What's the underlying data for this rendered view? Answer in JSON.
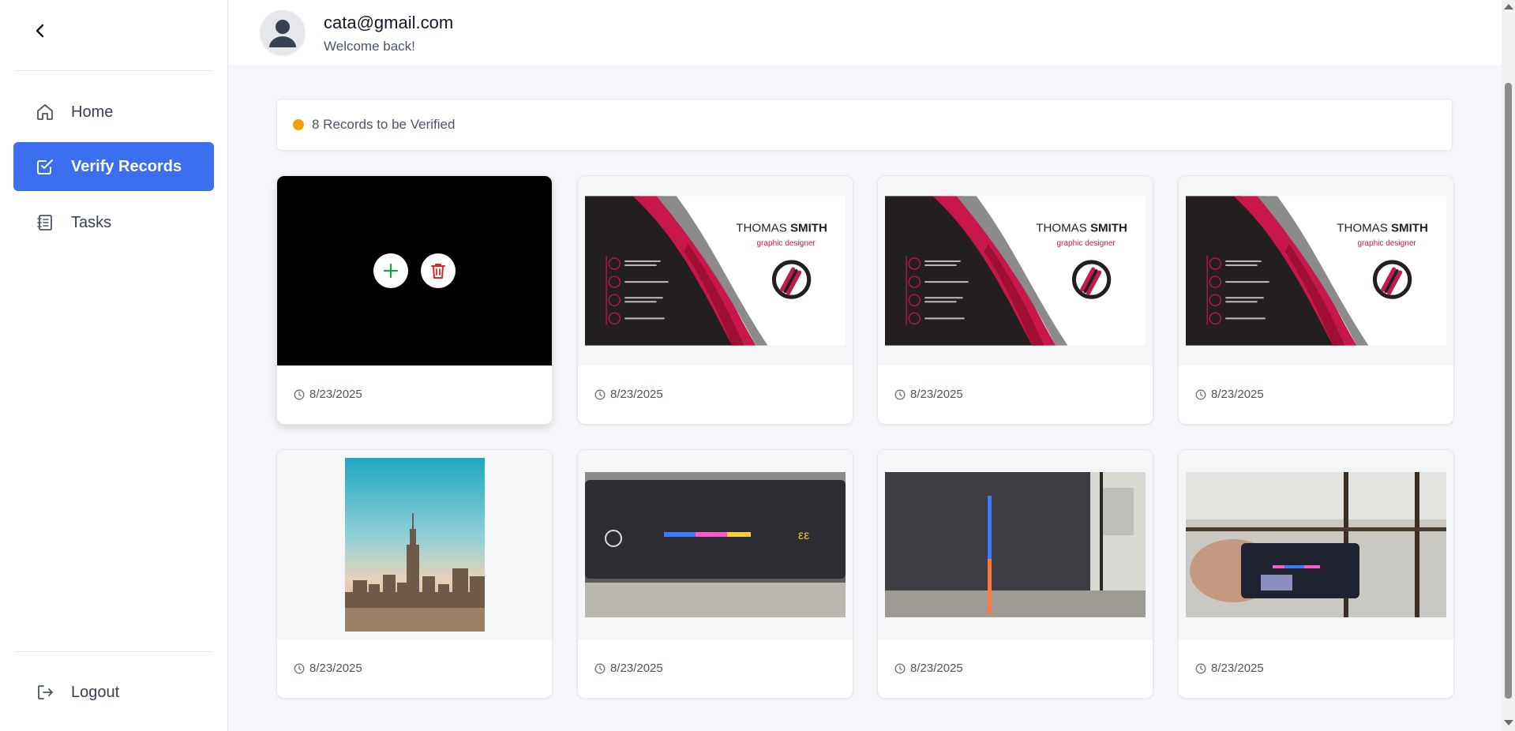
{
  "sidebar": {
    "back_icon": "chevron-left-icon",
    "items": [
      {
        "label": "Home",
        "icon": "home-icon",
        "active": false
      },
      {
        "label": "Verify Records",
        "icon": "check-square-icon",
        "active": true
      },
      {
        "label": "Tasks",
        "icon": "notebook-icon",
        "active": false
      }
    ],
    "logout": {
      "label": "Logout",
      "icon": "logout-icon"
    }
  },
  "header": {
    "email": "cata@gmail.com",
    "welcome": "Welcome back!"
  },
  "banner": {
    "text": "8 Records to be Verified",
    "dot_color": "#f59e0b"
  },
  "records": [
    {
      "type": "selected",
      "date": "8/23/2025"
    },
    {
      "type": "business-card",
      "name_first": "THOMAS",
      "name_last": "SMITH",
      "role": "graphic designer",
      "date": "8/23/2025"
    },
    {
      "type": "business-card",
      "name_first": "THOMAS",
      "name_last": "SMITH",
      "role": "graphic designer",
      "date": "8/23/2025"
    },
    {
      "type": "business-card",
      "name_first": "THOMAS",
      "name_last": "SMITH",
      "role": "graphic designer",
      "date": "8/23/2025"
    },
    {
      "type": "city-photo",
      "date": "8/23/2025"
    },
    {
      "type": "photo",
      "date": "8/23/2025"
    },
    {
      "type": "photo",
      "date": "8/23/2025"
    },
    {
      "type": "photo",
      "date": "8/23/2025"
    }
  ],
  "colors": {
    "accent": "#3b6ff0",
    "add_green": "#16a34a",
    "delete_red": "#dc2626",
    "card_red": "#c8174a"
  }
}
